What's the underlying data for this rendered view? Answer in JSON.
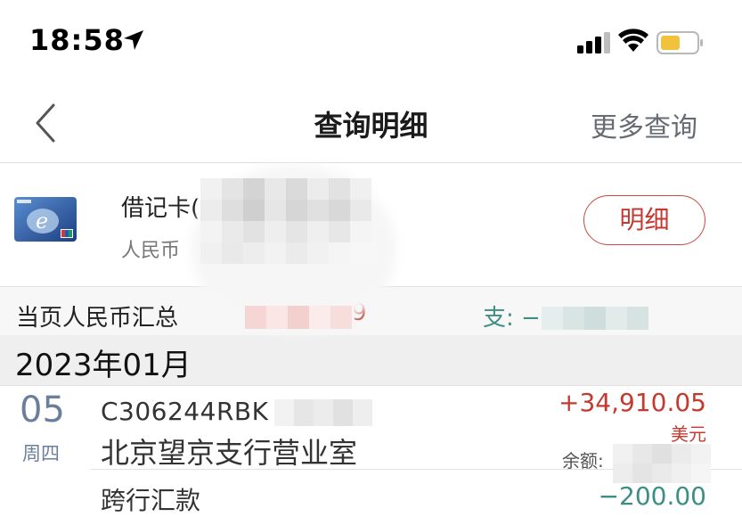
{
  "status_bar": {
    "time": "18:58"
  },
  "nav": {
    "title": "查询明细",
    "more_query": "更多查询"
  },
  "card": {
    "name": "借记卡(",
    "currency": "人民币",
    "detail_button": "明细"
  },
  "summary": {
    "label": "当页人民币汇总",
    "income": "9",
    "expense": "支: −"
  },
  "month": {
    "label": "2023年01月"
  },
  "transactions": [
    {
      "day": "05",
      "weekday": "周四",
      "code": "C306244RBK",
      "branch": "北京望京支行营业室",
      "amount": "+34,910.05",
      "currency": "美元",
      "balance_label": "余额:"
    },
    {
      "description": "跨行汇款",
      "amount": "−200.00"
    }
  ],
  "colors": {
    "income_red": "#c43a31",
    "expense_teal": "#3d8f86",
    "date_blue": "#6a7f9b"
  },
  "icons": [
    "back-chevron-icon",
    "location-arrow-icon",
    "cellular-signal-icon",
    "wifi-icon",
    "battery-icon",
    "card-logo-icon"
  ]
}
